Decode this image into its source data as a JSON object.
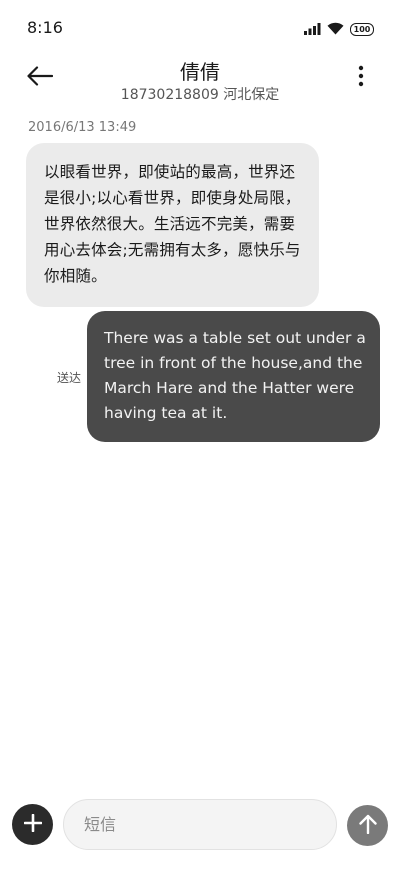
{
  "status_bar": {
    "time": "8:16",
    "battery": "100",
    "icons": [
      "signal-icon",
      "wifi-icon",
      "battery-icon"
    ]
  },
  "header": {
    "contact_name": "倩倩",
    "contact_detail": "18730218809 河北保定",
    "back_icon": "arrow-left-icon",
    "more_icon": "more-vertical-icon"
  },
  "conversation": {
    "timestamp": "2016/6/13 13:49",
    "messages": [
      {
        "direction": "incoming",
        "text": "以眼看世界，即使站的最高，世界还是很小;以心看世界，即使身处局限，世界依然很大。生活远不完美，需要用心去体会;无需拥有太多，愿快乐与你相随。"
      },
      {
        "direction": "outgoing",
        "text": "There was a table set out under a tree in front of the house,and the March Hare and the Hatter were having tea at it.",
        "status": "送达"
      }
    ]
  },
  "composer": {
    "placeholder": "短信",
    "value": "",
    "add_icon": "plus-icon",
    "send_icon": "arrow-up-icon"
  },
  "colors": {
    "incoming_bubble": "#ebebeb",
    "outgoing_bubble": "#4a4a4a",
    "send_button": "#7a7a7a",
    "add_button": "#2b2b2b"
  }
}
